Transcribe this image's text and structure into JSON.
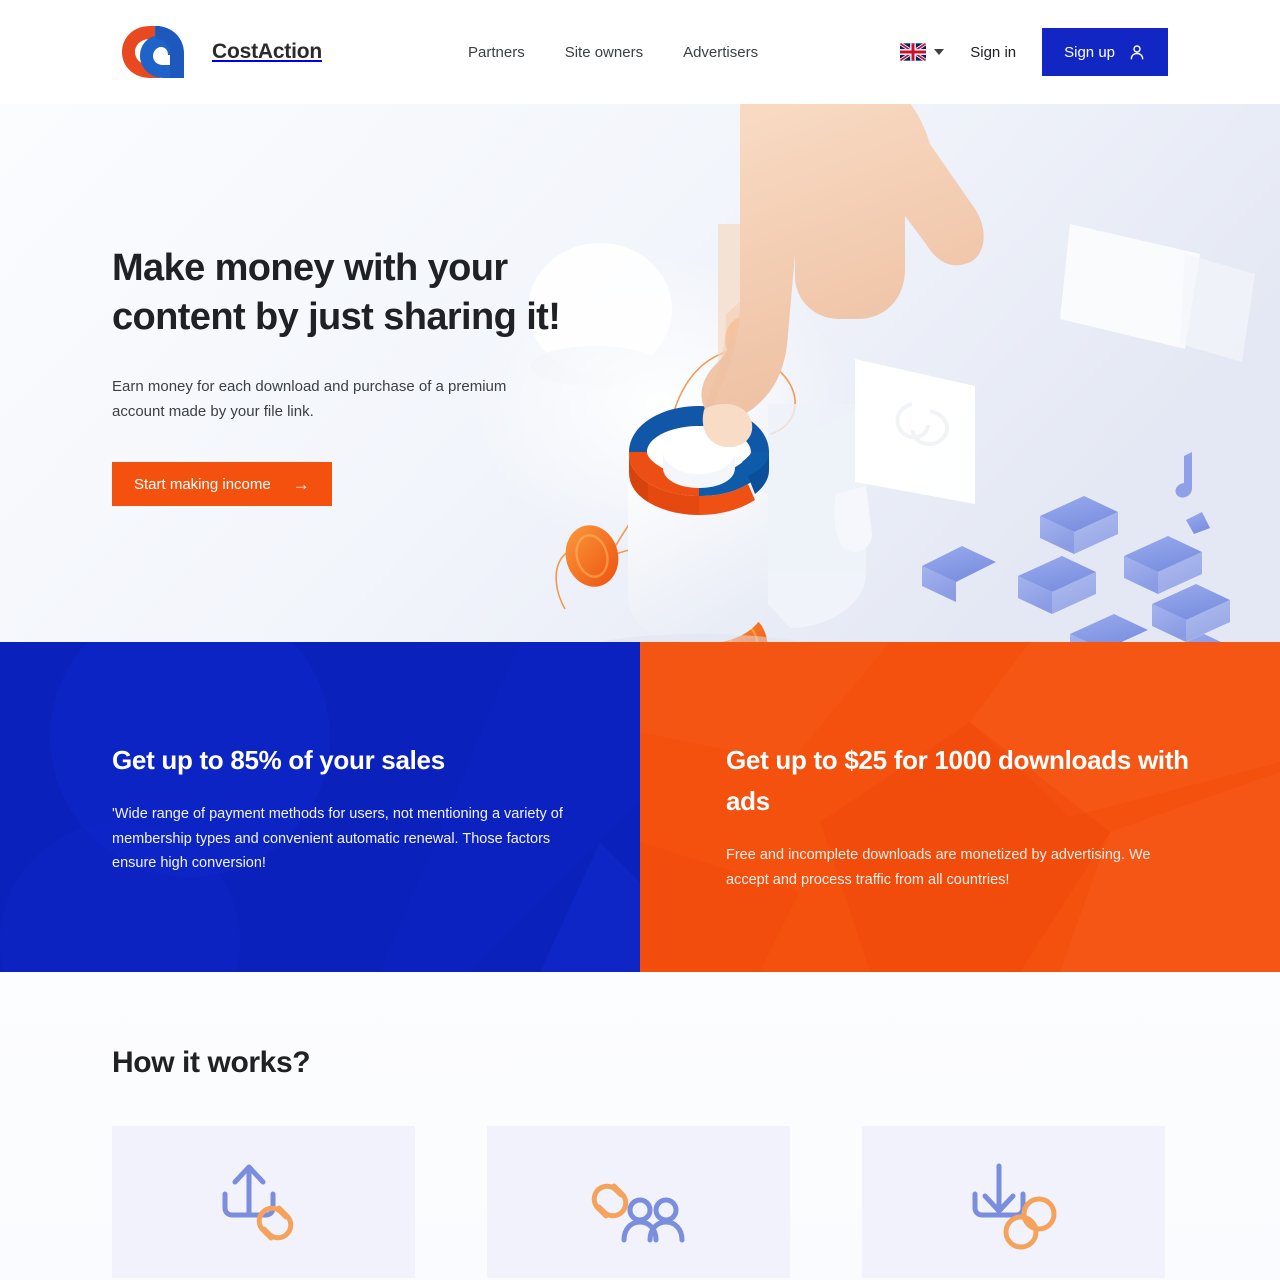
{
  "brand": {
    "name": "CostAction",
    "logo_icon": "costaction-logo-icon",
    "colors": {
      "orange": "#e8491f",
      "blue": "#1f63c8"
    }
  },
  "header": {
    "nav": [
      {
        "label": "Partners",
        "name": "partners"
      },
      {
        "label": "Site owners",
        "name": "site-owners"
      },
      {
        "label": "Advertisers",
        "name": "advertisers"
      }
    ],
    "language": {
      "selected": "en",
      "flag_icon": "uk-flag-icon",
      "chevron_icon": "chevron-down-icon"
    },
    "sign_in_label": "Sign in",
    "sign_up_label": "Sign up",
    "sign_up_icon": "user-icon",
    "sign_up_bg": "#1226c4"
  },
  "hero": {
    "title_line_1": "Make money with your",
    "title_line_2": "content by just sharing it!",
    "subtitle": "Earn money for each download and purchase of a premium account made by your file link.",
    "cta_label": "Start making income",
    "cta_arrow": "→",
    "cta_bg": "#f4510f",
    "illustration_name": "hand-pressing-button-with-coins-illustration"
  },
  "panels": [
    {
      "name": "sales-share-panel",
      "heading": "Get up to 85% of your sales",
      "body": "'Wide range of payment methods for users, not mentioning a variety of membership types and convenient automatic renewal. Those factors ensure high conversion!",
      "bg": "#0b21bc"
    },
    {
      "name": "ads-revenue-panel",
      "heading": "Get up to $25 for 1000 downloads with ads",
      "body": "Free and incomplete downloads are monetized by advertising. We accept and process traffic from all countries!",
      "bg": "#f4510f"
    }
  ],
  "how_it_works": {
    "title": "How it works?",
    "cards": [
      {
        "name": "upload-file-card",
        "icon": "upload-link-icon"
      },
      {
        "name": "share-link-card",
        "icon": "link-users-icon"
      },
      {
        "name": "earn-money-card",
        "icon": "download-coins-icon"
      }
    ],
    "card_bg": "#f1f2fb",
    "icon_blue": "#7b8ede",
    "icon_orange": "#f5a35c"
  }
}
